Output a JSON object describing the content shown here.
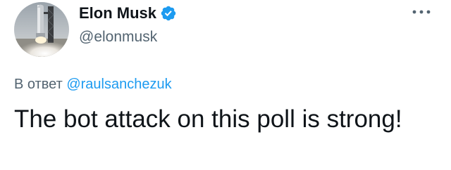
{
  "author": {
    "display_name": "Elon Musk",
    "handle": "@elonmusk",
    "verified": true,
    "verified_icon": "verified-badge-icon",
    "avatar_icon": "rocket-launch-avatar"
  },
  "menu": {
    "more_icon": "more-horizontal-icon"
  },
  "reply": {
    "prefix": "В ответ",
    "mention": "@raulsanchezuk"
  },
  "tweet": {
    "text": "The bot attack on this poll is strong!"
  },
  "colors": {
    "text_primary": "#0f1419",
    "text_secondary": "#536471",
    "link": "#1d9bf0",
    "verified": "#1d9bf0",
    "background": "#ffffff"
  }
}
